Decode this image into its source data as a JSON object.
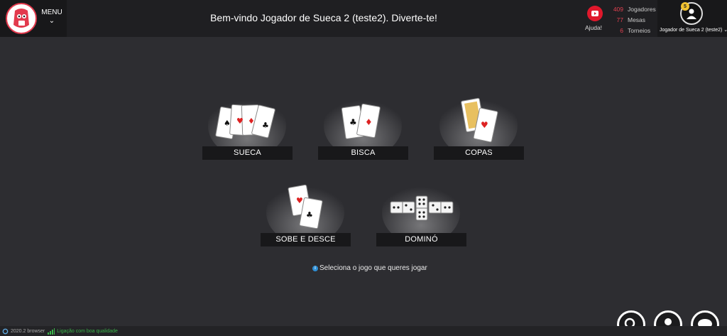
{
  "header": {
    "menu_label": "MENU",
    "welcome_text": "Bem-vindo Jogador de Sueca 2 (teste2). Diverte-te!",
    "help_label": "Ajuda!",
    "stats": [
      {
        "value": "409",
        "label": "Jogadores"
      },
      {
        "value": "77",
        "label": "Mesas"
      },
      {
        "value": "6",
        "label": "Torneios"
      }
    ],
    "profile": {
      "level": "5",
      "name": "Jogador de Sueca 2 (teste2)"
    }
  },
  "games": [
    {
      "label": "SUECA"
    },
    {
      "label": "BISCA"
    },
    {
      "label": "COPAS"
    },
    {
      "label": "SOBE E DESCE"
    },
    {
      "label": "DOMINÓ"
    }
  ],
  "hint_text": "Seleciona o jogo que queres jogar",
  "footer": {
    "version": "2020.2 browser",
    "connection": "Ligação com boa qualidade"
  },
  "colors": {
    "accent": "#e04050",
    "background": "#2d2d31",
    "connection_ok": "#3bb34a"
  }
}
